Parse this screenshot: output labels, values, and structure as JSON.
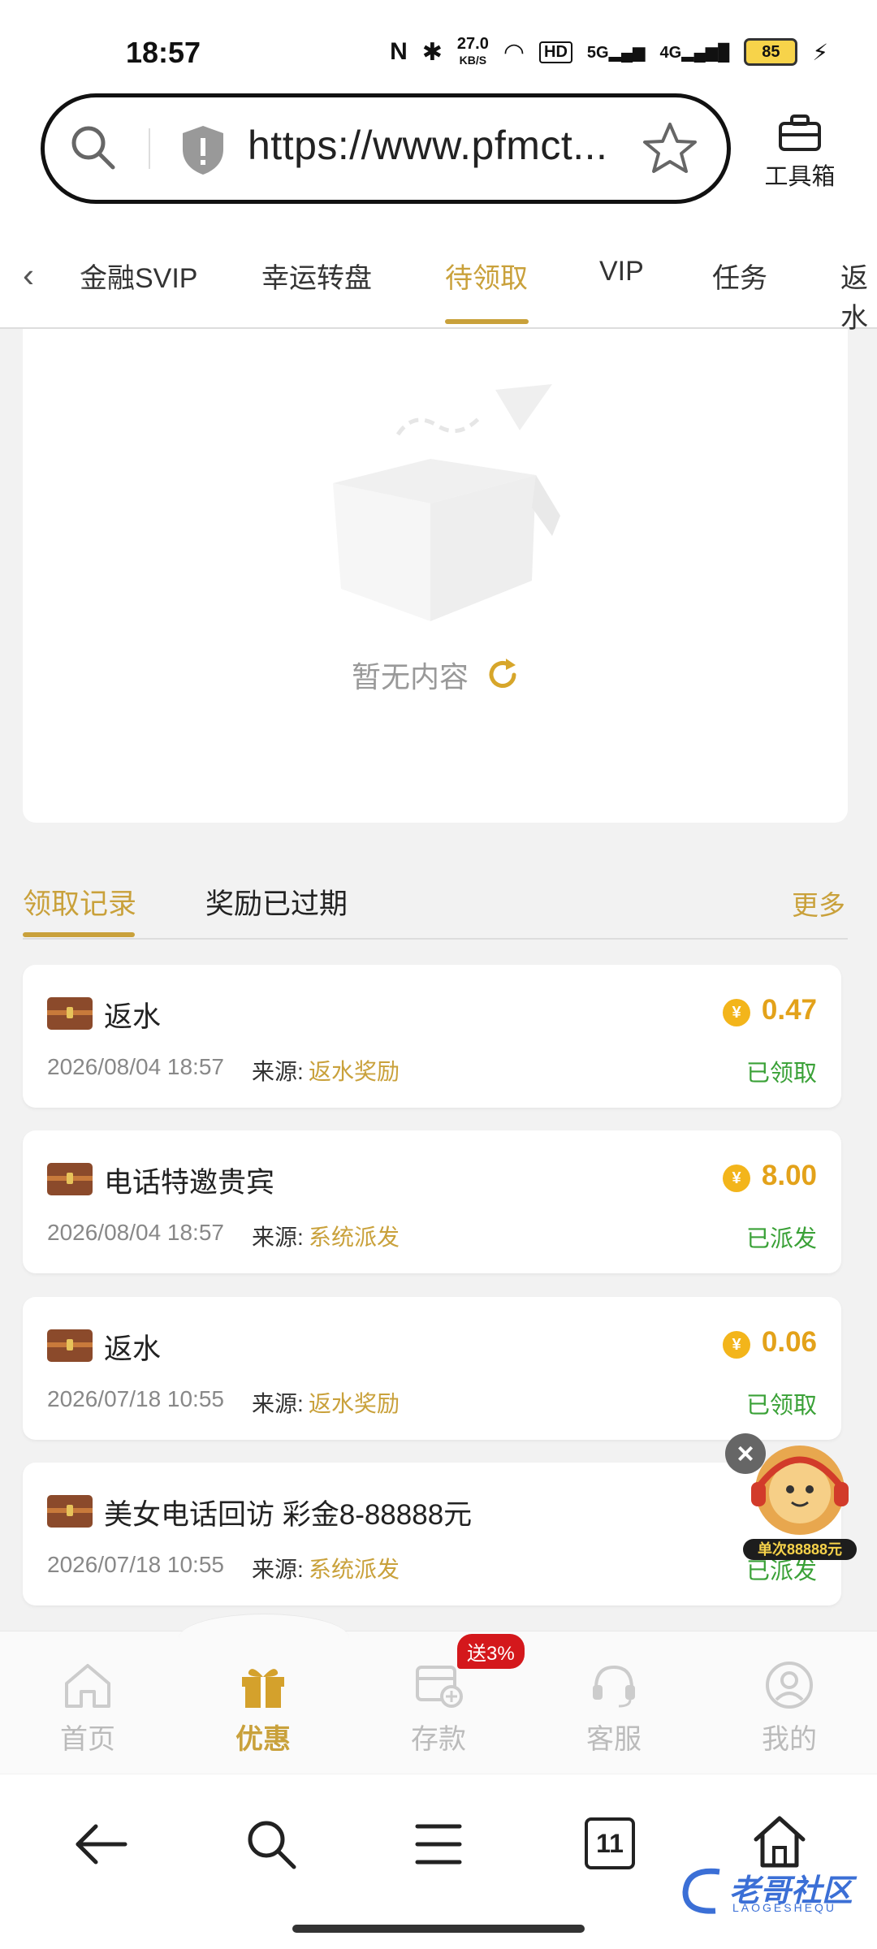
{
  "status_bar": {
    "time": "18:57",
    "net_speed_top": "27.0",
    "net_speed_unit": "KB/S",
    "hd_label": "HD",
    "signal1": "5G",
    "signal2": "4G",
    "battery": "85"
  },
  "browser": {
    "url": "https://www.pfmct...",
    "toolbox_label": "工具箱"
  },
  "tabs": [
    {
      "label": "金融SVIP"
    },
    {
      "label": "幸运转盘"
    },
    {
      "label": "待领取"
    },
    {
      "label": "VIP"
    },
    {
      "label": "任务"
    },
    {
      "label": "返水"
    }
  ],
  "empty_state": {
    "text": "暂无内容"
  },
  "records": {
    "tab_claimed": "领取记录",
    "tab_expired": "奖励已过期",
    "more": "更多",
    "source_label": "来源:",
    "items": [
      {
        "title": "返水",
        "date": "2026/08/04 18:57",
        "source": "返水奖励",
        "amount": "0.47",
        "status": "已领取"
      },
      {
        "title": "电话特邀贵宾",
        "date": "2026/08/04 18:57",
        "source": "系统派发",
        "amount": "8.00",
        "status": "已派发"
      },
      {
        "title": "返水",
        "date": "2026/07/18 10:55",
        "source": "返水奖励",
        "amount": "0.06",
        "status": "已领取"
      },
      {
        "title": "美女电话回访 彩金8-88888元",
        "date": "2026/07/18 10:55",
        "source": "系统派发",
        "amount": "",
        "status": "已派发"
      }
    ]
  },
  "floating_promo": {
    "text": "单次88888元"
  },
  "app_nav": {
    "items": [
      {
        "label": "首页"
      },
      {
        "label": "优惠"
      },
      {
        "label": "存款"
      },
      {
        "label": "客服"
      },
      {
        "label": "我的"
      }
    ],
    "deposit_badge": "送3%"
  },
  "browser_bottom": {
    "tab_count": "11"
  },
  "watermark": {
    "text": "老哥社区",
    "sub": "LAOGESHEQU"
  },
  "colors": {
    "accent": "#c9a13b",
    "success": "#3aa137",
    "amount": "#e3a21a",
    "badge": "#d4181c"
  }
}
